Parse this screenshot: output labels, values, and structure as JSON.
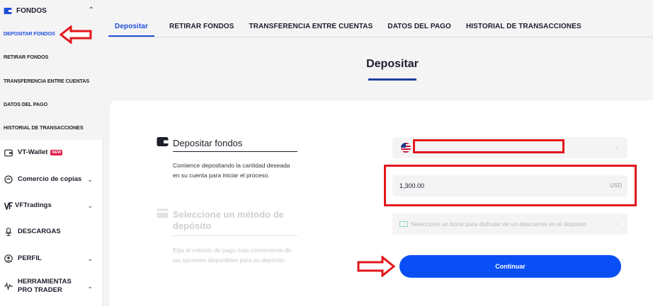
{
  "sidebar": {
    "group_label": "FONDOS",
    "sub_items": [
      "DEPOSITAR FONDOS",
      "RETIRAR FONDOS",
      "TRANSFERENCIA ENTRE CUENTAS",
      "DATOS DEL PAGO",
      "HISTORIAL DE TRANSACCIONES"
    ],
    "items": [
      {
        "label": "VT-Wallet",
        "badge": "NEW",
        "icon": "wallet-icon"
      },
      {
        "label": "Comercio de copias",
        "icon": "copy-trade-icon"
      },
      {
        "label": "VFTradings",
        "icon": "vf-logo-icon"
      },
      {
        "label": "DESCARGAS",
        "icon": "download-icon"
      },
      {
        "label": "PERFIL",
        "icon": "user-icon"
      },
      {
        "label": "HERRAMIENTAS PRO TRADER",
        "icon": "pro-tools-icon"
      }
    ]
  },
  "tabs": [
    "Depositar",
    "RETIRAR FONDOS",
    "TRANSFERENCIA ENTRE CUENTAS",
    "DATOS DEL PAGO",
    "HISTORIAL DE TRANSACCIONES"
  ],
  "page_title": "Depositar",
  "step1": {
    "title": "Depositar fondos",
    "description": "Comience depositando la cantidad deseada en su cuenta para iniciar el proceso."
  },
  "step2": {
    "title": "Seleccione un método de depósito",
    "description": "Elija el método de pago más conveniente de las opciones disponibles para su depósito."
  },
  "form": {
    "amount_value": "1,300.00",
    "currency": "USD",
    "bonus_placeholder": "Seleccione un bono para disfrutar de un descuento en el depósito.",
    "submit_label": "Continuar"
  },
  "colors": {
    "accent": "#1f4fd8",
    "button": "#0a4ff5",
    "annotation_red": "#e3161c"
  }
}
